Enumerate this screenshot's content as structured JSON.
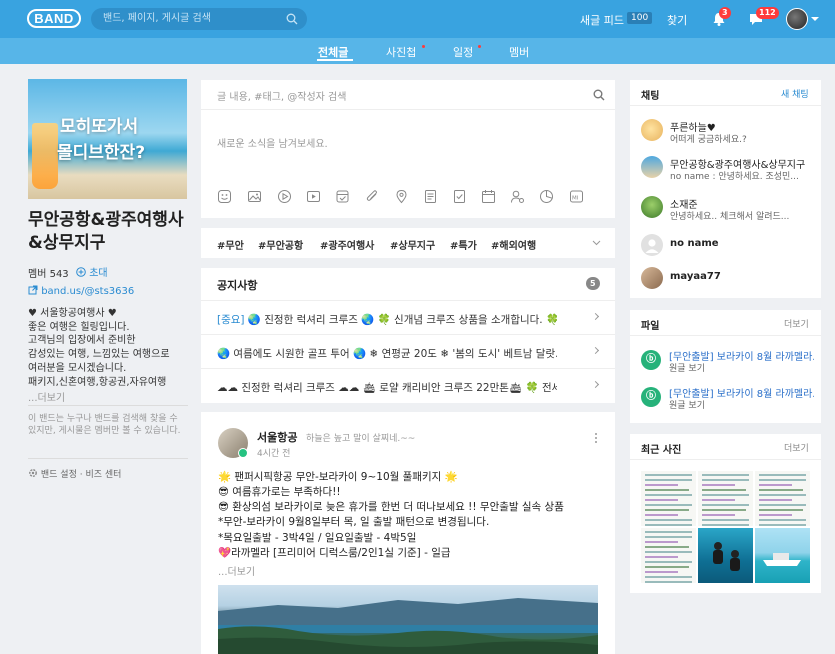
{
  "topbar": {
    "logo": "BAND",
    "search_placeholder": "밴드, 페이지, 게시글 검색",
    "new_feed_label": "새글 피드",
    "new_feed_count": "100",
    "find_label": "찾기",
    "notifications_badge": "3",
    "messages_badge": "112"
  },
  "tabs": [
    {
      "label": "전체글",
      "active": true
    },
    {
      "label": "사진첩"
    },
    {
      "label": "일정"
    },
    {
      "label": "멤버"
    }
  ],
  "band": {
    "cover_text_1": "모히또가서",
    "cover_text_2": "몰디브한잔?",
    "title": "무안공항&광주여행사&상무지구",
    "members_label": "멤버 543",
    "invite_label": "초대",
    "link": "band.us/@sts3636",
    "description": [
      "♥ 서울항공여행사 ♥",
      "좋은 여행은 힐링입니다.",
      "고객님의 입장에서 준비한",
      "감성있는 여행, 느낌있는 여행으로",
      "여러분을 모시겠습니다.",
      "패키지,신혼여행,항공권,자유여행"
    ],
    "more_label": "...더보기",
    "note": "이 밴드는 누구나 밴드를 검색해 찾을 수 있지만, 게시물은 멤버만 볼 수 있습니다.",
    "settings_label": "밴드 설정",
    "biz_label": "비즈 센터"
  },
  "feed": {
    "search_placeholder": "글 내용, #태그, @작성자 검색",
    "write_placeholder": "새로운 소식을 남겨보세요.",
    "tags": [
      "#무안",
      "#무안공항",
      "#광주여행사",
      "#상무지구",
      "#특가",
      "#해외여행"
    ],
    "notice": {
      "title": "공지사항",
      "count": "5",
      "items": [
        {
          "prefix": "[중요]",
          "text": "🌏 진정한 럭셔리 크루즈 🌏 🍀 신개념 크루즈 상품을 소개합니다. 🍀"
        },
        {
          "prefix": "",
          "text": "🌏 여름에도 시원한 골프 투어 🌏 ❄ 연평균 20도 ❄ '봄의 도시' 베트남 달랏..."
        },
        {
          "prefix": "",
          "text": "☁☁ 진정한 럭셔리 크루즈 ☁☁ 🛳 로얄 캐리비안 크루즈 22만톤🛳 🍀 전세..."
        }
      ]
    },
    "post": {
      "author": "서울항공",
      "tagline": "하늘은 높고 말이 살찌네.~~",
      "time": "4시간 전",
      "lines": [
        "🌟 팬퍼시픽항공 무안-보라카이 9~10월 풀패키지 🌟",
        "😎 여름휴가로는 부족하다!!",
        "😎 환상의섬 보라카이로 늦은 휴가를 한번 더 떠나보세요 !! 무안출발 실속 상품",
        "*무안-보라카이 9월8일부터 목, 일 출발 패턴으로 변경됩니다.",
        "*목요일출발 - 3박4일 / 일요일출발 - 4박5일",
        "💖라까멜라 [프리미어 디럭스룸/2인1실 기준] - 일급"
      ],
      "more_label": "...더보기"
    }
  },
  "chat": {
    "title": "채팅",
    "new_chat_label": "새 채팅",
    "items": [
      {
        "name": "푸른하늘♥",
        "msg": "어떠게 궁금하세요.?"
      },
      {
        "name": "무안공항&광주여행사&상무지구",
        "msg": "no name : 안녕하세요. 조성민..."
      },
      {
        "name": "소재준",
        "msg": "안녕하세요.. 체크해서 알려드..."
      },
      {
        "name": "no name",
        "msg": ""
      },
      {
        "name": "mayaa77",
        "msg": ""
      }
    ]
  },
  "files": {
    "title": "파일",
    "more_label": "더보기",
    "items": [
      {
        "name": "[무안출발] 보라카이 8월 라까멜라...",
        "sub": "원글 보기"
      },
      {
        "name": "[무안출발] 보라카이 8월 라까멜라...",
        "sub": "원글 보기"
      }
    ]
  },
  "photos": {
    "title": "최근 사진",
    "more_label": "더보기"
  },
  "colors": {
    "topbar": "#39a3e0",
    "tabbar": "#57b5e8",
    "link": "#2a8bd1",
    "badge": "#ff3b3b",
    "file_icon": "#26b27a"
  }
}
